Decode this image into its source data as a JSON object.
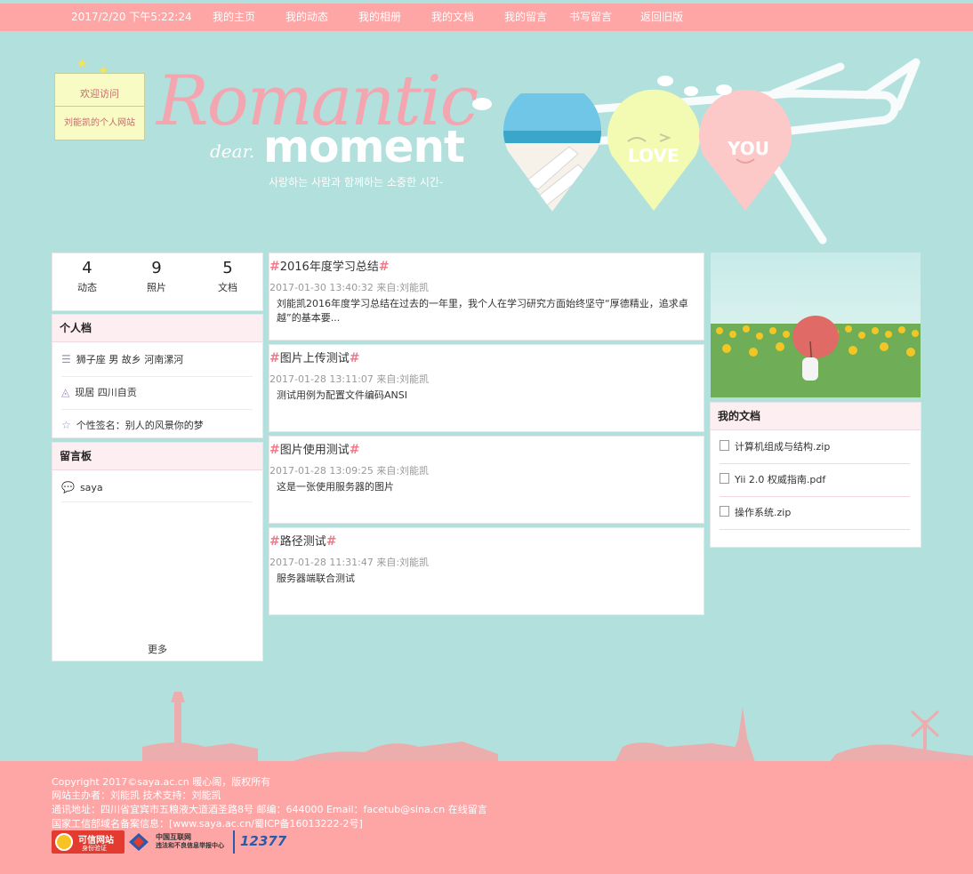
{
  "nav": {
    "clock": "2017/2/20 下午5:22:24",
    "items": [
      "我的主页",
      "我的动态",
      "我的相册",
      "我的文档",
      "我的留言",
      "书写留言",
      "返回旧版"
    ]
  },
  "banner": {
    "sticky_line1": "欢迎访问",
    "sticky_line2": "刘能凯的个人网站",
    "logo_romantic": "Romantic",
    "logo_dear": "dear.",
    "logo_moment": "moment",
    "logo_sub": "사랑하는 사람과 함께하는 소중한 시간-",
    "balloon_love": "LOVE",
    "balloon_you": "YOU"
  },
  "stats": [
    {
      "num": "4",
      "label": "动态"
    },
    {
      "num": "9",
      "label": "照片"
    },
    {
      "num": "5",
      "label": "文档"
    }
  ],
  "profile": {
    "header": "个人档",
    "items": [
      {
        "icon": "id-card-icon",
        "text": "狮子座 男 故乡 河南漯河"
      },
      {
        "icon": "location-icon",
        "text": "现居 四川自贡"
      },
      {
        "icon": "star-outline-icon",
        "text": "个性签名：别人的风景你的梦"
      }
    ]
  },
  "guestbook": {
    "header": "留言板",
    "items": [
      {
        "icon": "chat-bubble-icon",
        "text": "saya"
      }
    ],
    "more": "更多"
  },
  "posts": [
    {
      "title": "2016年度学习总结",
      "meta": "2017-01-30 13:40:32 来自:刘能凯",
      "body": "刘能凯2016年度学习总结在过去的一年里，我个人在学习研究方面始终坚守“厚德精业，追求卓越”的基本要..."
    },
    {
      "title": "图片上传测试",
      "meta": "2017-01-28 13:11:07 来自:刘能凯",
      "body": "测试用例为配置文件编码ANSI"
    },
    {
      "title": "图片使用测试",
      "meta": "2017-01-28 13:09:25 来自:刘能凯",
      "body": "这是一张使用服务器的图片"
    },
    {
      "title": "路径测试",
      "meta": "2017-01-28 11:31:47 来自:刘能凯",
      "body": "服务器端联合测试"
    }
  ],
  "documents": {
    "header": "我的文档",
    "items": [
      "计算机组成与结构.zip",
      "Yii 2.0 权威指南.pdf",
      "操作系统.zip"
    ]
  },
  "footer": {
    "lines": [
      "Copyright 2017©saya.ac.cn 暖心阁，版权所有",
      "网站主办者：刘能凯 技术支持：刘能凯",
      "通讯地址：四川省宜宾市五粮液大道酒圣路8号 邮编：644000  Email：facetub@sina.cn 在线留言",
      "国家工信部域名备案信息：[www.saya.ac.cn/蜀ICP备16013222-2号]"
    ],
    "badge1_line1": "可信网站",
    "badge1_line2": "身份验证",
    "badge2_line1": "中国互联网",
    "badge2_line2": "违法和不良信息举报中心",
    "badge3": "12377"
  },
  "colors": {
    "page_bg": "#b2e0dd",
    "nav_bg": "#fea6a6",
    "panel_head_bg": "#fdeef1",
    "hash_accent": "#ef7a8a"
  }
}
